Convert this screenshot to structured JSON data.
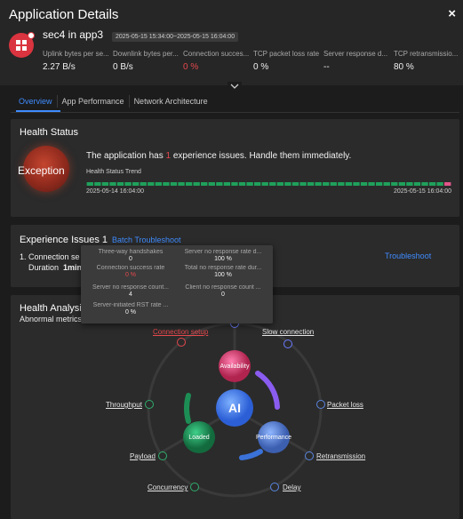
{
  "window": {
    "title": "Application Details",
    "close_glyph": "×"
  },
  "app": {
    "name": "sec4 in app3",
    "time_range": "2025-05-15 15:34:00~2025-05-15 16:04:00",
    "icon": "app-grid-icon"
  },
  "metrics": [
    {
      "label": "Uplink bytes per se...",
      "value": "2.27 B/s"
    },
    {
      "label": "Downlink bytes per...",
      "value": "0 B/s"
    },
    {
      "label": "Connection succes...",
      "value": "0 %"
    },
    {
      "label": "TCP packet loss rate",
      "value": "0 %"
    },
    {
      "label": "Server response d...",
      "value": "--"
    },
    {
      "label": "TCP retransmissio...",
      "value": "80 %"
    }
  ],
  "tabs": [
    {
      "label": "Overview",
      "active": true
    },
    {
      "label": "App Performance",
      "active": false
    },
    {
      "label": "Network Architecture",
      "active": false
    }
  ],
  "health_status": {
    "title": "Health Status",
    "state": "Exception",
    "message_pre": "The application has ",
    "issue_count": "1",
    "message_post": " experience issues. Handle them immediately.",
    "trend_label": "Health Status Trend",
    "start": "2025-05-14 16:04:00",
    "end": "2025-05-15 16:04:00",
    "colors": {
      "normal": "#1fa05b",
      "abnormal": "#e0568a"
    }
  },
  "experience_issues": {
    "title": "Experience Issues 1",
    "batch_label": "Batch Troubleshoot",
    "row1": "1. Connection se",
    "row2_label": "Duration",
    "row2_value": "1min",
    "troubleshoot_label": "Troubleshoot"
  },
  "tooltip": {
    "items": [
      {
        "key": "Three-way handshakes",
        "value": "0"
      },
      {
        "key": "Server no response rate d...",
        "value": "100 %"
      },
      {
        "key": "Connection success rate",
        "value": "0 %",
        "red": true
      },
      {
        "key": "Total no response rate dur...",
        "value": "100 %"
      },
      {
        "key": "Server no response count...",
        "value": "4"
      },
      {
        "key": "Client no response count ...",
        "value": "0"
      },
      {
        "key": "Server-initiated RST rate ...",
        "value": "0 %"
      }
    ]
  },
  "health_analysis": {
    "title": "Health Analysis",
    "subtitle": "Abnormal metrics",
    "center": "AI",
    "nodes": {
      "availability": "Availability",
      "loaded": "Loaded",
      "performance": "Performance"
    },
    "metrics": {
      "connection_setup": "Connection setup",
      "slow_connection": "Slow connection",
      "packet_loss": "Packet loss",
      "retransmission": "Retransmission",
      "delay": "Delay",
      "concurrency": "Concurrency",
      "payload": "Payload",
      "throughput": "Throughput"
    }
  }
}
